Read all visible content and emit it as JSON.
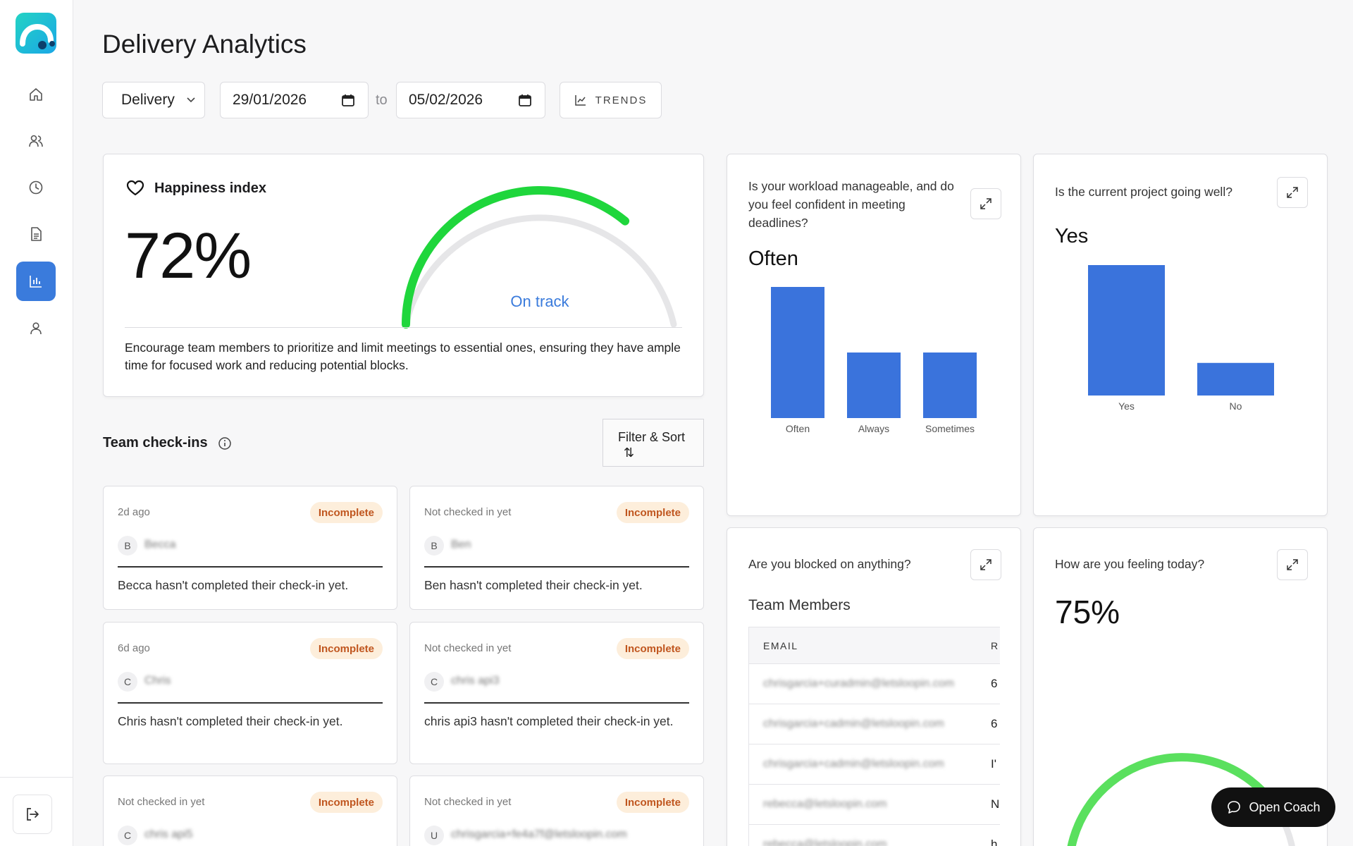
{
  "page": {
    "title": "Delivery Analytics"
  },
  "filters": {
    "team_select": "Delivery",
    "date_from": "29/01/2026",
    "to_label": "to",
    "date_to": "05/02/2026",
    "trends_label": "TRENDS"
  },
  "happiness": {
    "title": "Happiness index",
    "value": "72%",
    "status": "On track",
    "level": 0.72,
    "message": "Encourage team members to prioritize and limit meetings to essential ones, ensuring they have ample time for focused work and reducing potential blocks."
  },
  "questions": {
    "workload": {
      "question": "Is your workload manageable, and do you feel confident in meeting deadlines?",
      "answer": "Often",
      "chart_data": {
        "type": "bar",
        "categories": [
          "Often",
          "Always",
          "Sometimes"
        ],
        "values": [
          3,
          1.5,
          1.5
        ],
        "ylim": [
          0,
          3
        ]
      }
    },
    "project": {
      "question": "Is the current project going well?",
      "answer": "Yes",
      "chart_data": {
        "type": "bar",
        "categories": [
          "Yes",
          "No"
        ],
        "values": [
          4,
          1
        ],
        "ylim": [
          0,
          4
        ]
      }
    },
    "blocked": {
      "question": "Are you blocked on anything?",
      "table_title": "Team Members",
      "columns": [
        "EMAIL",
        "R"
      ],
      "rows": [
        {
          "email": "chrisgarcia+curadmin@letsloopin.com",
          "r": "6"
        },
        {
          "email": "chrisgarcia+cadmin@letsloopin.com",
          "r": "6"
        },
        {
          "email": "chrisgarcia+cadmin@letsloopin.com",
          "r": "I'"
        },
        {
          "email": "rebecca@letsloopin.com",
          "r": "N"
        },
        {
          "email": "rebecca@letsloopin.com",
          "r": "h"
        }
      ]
    },
    "feeling": {
      "question": "How are you feeling today?",
      "value": "75%",
      "level": 0.75
    }
  },
  "checkins": {
    "title": "Team check-ins",
    "filter_label": "Filter & Sort",
    "filter_icon": "⇅",
    "items": [
      {
        "when": "2d ago",
        "badge": "Incomplete",
        "initial": "B",
        "name": "Becca",
        "message": "Becca hasn't completed their check-in yet."
      },
      {
        "when": "Not checked in yet",
        "badge": "Incomplete",
        "initial": "B",
        "name": "Ben",
        "message": "Ben hasn't completed their check-in yet."
      },
      {
        "when": "6d ago",
        "badge": "Incomplete",
        "initial": "C",
        "name": "Chris",
        "message": "Chris hasn't completed their check-in yet."
      },
      {
        "when": "Not checked in yet",
        "badge": "Incomplete",
        "initial": "C",
        "name": "chris api3",
        "message": "chris api3 hasn't completed their check-in yet."
      },
      {
        "when": "Not checked in yet",
        "badge": "Incomplete",
        "initial": "C",
        "name": "chris api5",
        "message": ""
      },
      {
        "when": "Not checked in yet",
        "badge": "Incomplete",
        "initial": "U",
        "name": "chrisgarcia+fe4a7f@letsloopin.com",
        "message": ""
      }
    ]
  },
  "coach": {
    "label": "Open Coach"
  },
  "colors": {
    "accent": "#3a7bdc",
    "gauge_green": "#1fd63c",
    "gauge_track": "#e6e6e8",
    "badge_bg": "#fdeedb",
    "badge_text": "#c0561f"
  }
}
